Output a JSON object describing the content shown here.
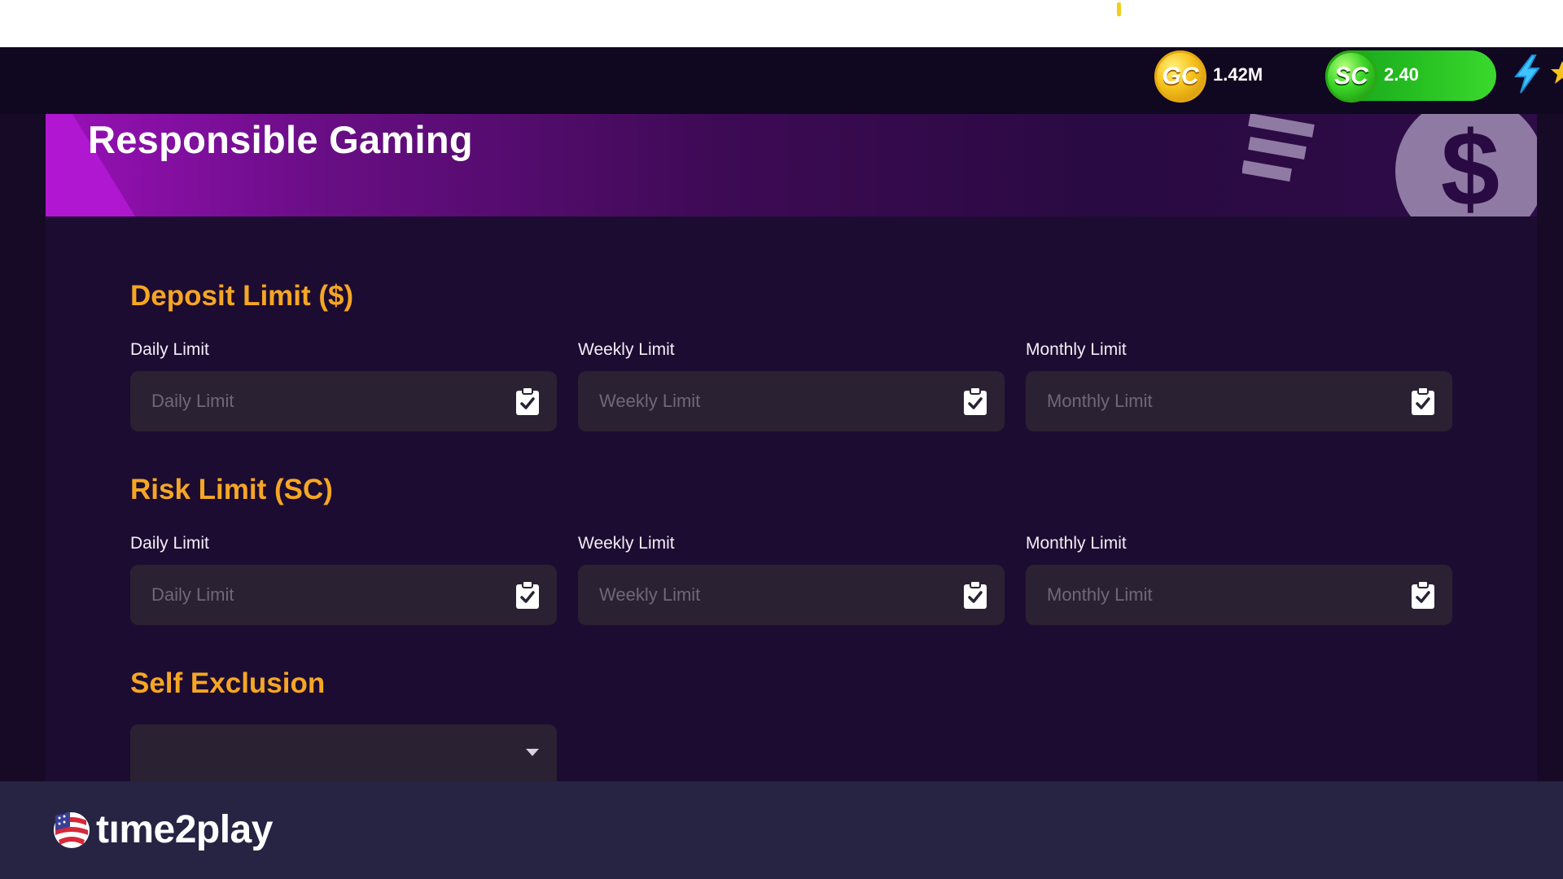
{
  "header": {
    "gc": {
      "icon": "gc-coin-icon",
      "coin_label": "GC",
      "balance": "1.42M"
    },
    "sc": {
      "icon": "sc-coin-icon",
      "coin_label": "SC",
      "balance": "2.40"
    },
    "boost_icon": "lightning-bolt-icon"
  },
  "banner": {
    "title": "Responsible Gaming",
    "art_icon": "dollar-coin-icon"
  },
  "deposit": {
    "title": "Deposit Limit ($)",
    "fields": [
      {
        "label": "Daily Limit",
        "placeholder": "Daily Limit",
        "value": ""
      },
      {
        "label": "Weekly Limit",
        "placeholder": "Weekly Limit",
        "value": ""
      },
      {
        "label": "Monthly Limit",
        "placeholder": "Monthly Limit",
        "value": ""
      }
    ]
  },
  "risk": {
    "title": "Risk Limit (SC)",
    "fields": [
      {
        "label": "Daily Limit",
        "placeholder": "Daily Limit",
        "value": ""
      },
      {
        "label": "Weekly Limit",
        "placeholder": "Weekly Limit",
        "value": ""
      },
      {
        "label": "Monthly Limit",
        "placeholder": "Monthly Limit",
        "value": ""
      }
    ]
  },
  "self_exclusion": {
    "title": "Self Exclusion",
    "selected": ""
  },
  "footer": {
    "brand": "tıme2play"
  },
  "colors": {
    "section_title": "#f5a623",
    "background": "#1d0c31",
    "field_bg": "#2a2233",
    "sc_pill": "#29c322",
    "footer_bg": "#272343"
  }
}
